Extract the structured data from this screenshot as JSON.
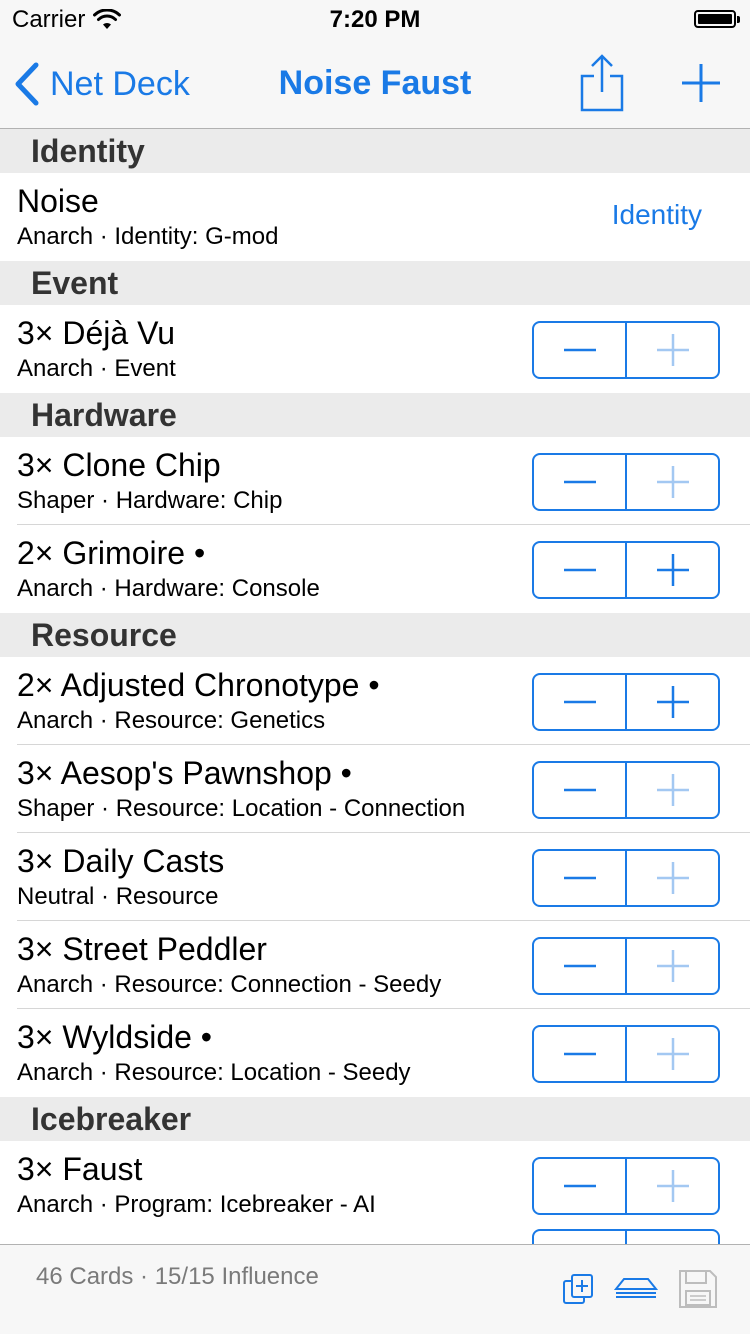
{
  "status_bar": {
    "carrier": "Carrier",
    "time": "7:20 PM"
  },
  "nav": {
    "back_label": "Net Deck",
    "title": "Noise Faust",
    "share_icon": "share-icon",
    "add_icon": "plus-icon"
  },
  "sections": [
    {
      "title": "Identity"
    },
    {
      "title": "Event"
    },
    {
      "title": "Hardware"
    },
    {
      "title": "Resource"
    },
    {
      "title": "Icebreaker"
    }
  ],
  "identity": {
    "name": "Noise",
    "subtitle": "Anarch · Identity: G-mod",
    "action": "Identity"
  },
  "cards": [
    {
      "title": "3× Déjà Vu",
      "subtitle": "Anarch · Event",
      "plus_enabled": false
    },
    {
      "title": "3× Clone Chip",
      "subtitle": "Shaper · Hardware: Chip",
      "plus_enabled": false
    },
    {
      "title": "2× Grimoire •",
      "subtitle": "Anarch · Hardware: Console",
      "plus_enabled": true
    },
    {
      "title": "2× Adjusted Chronotype •",
      "subtitle": "Anarch · Resource: Genetics",
      "plus_enabled": true
    },
    {
      "title": "3× Aesop's Pawnshop •",
      "subtitle": "Shaper · Resource: Location - Connection",
      "plus_enabled": false
    },
    {
      "title": "3× Daily Casts",
      "subtitle": "Neutral · Resource",
      "plus_enabled": false
    },
    {
      "title": "3× Street Peddler",
      "subtitle": "Anarch · Resource: Connection - Seedy",
      "plus_enabled": false
    },
    {
      "title": "3× Wyldside •",
      "subtitle": "Anarch · Resource: Location - Seedy",
      "plus_enabled": false
    },
    {
      "title": "3× Faust",
      "subtitle": "Anarch · Program: Icebreaker - AI",
      "plus_enabled": false
    }
  ],
  "toolbar": {
    "summary": "46 Cards · 15/15 Influence",
    "icons": [
      "duplicate-icon",
      "draw-simulator-icon",
      "save-icon"
    ]
  },
  "colors": {
    "accent": "#1a7ae6",
    "accent_disabled": "#a3c8f2",
    "section_bg": "#ebebeb",
    "bar_bg": "#f7f7f7"
  }
}
